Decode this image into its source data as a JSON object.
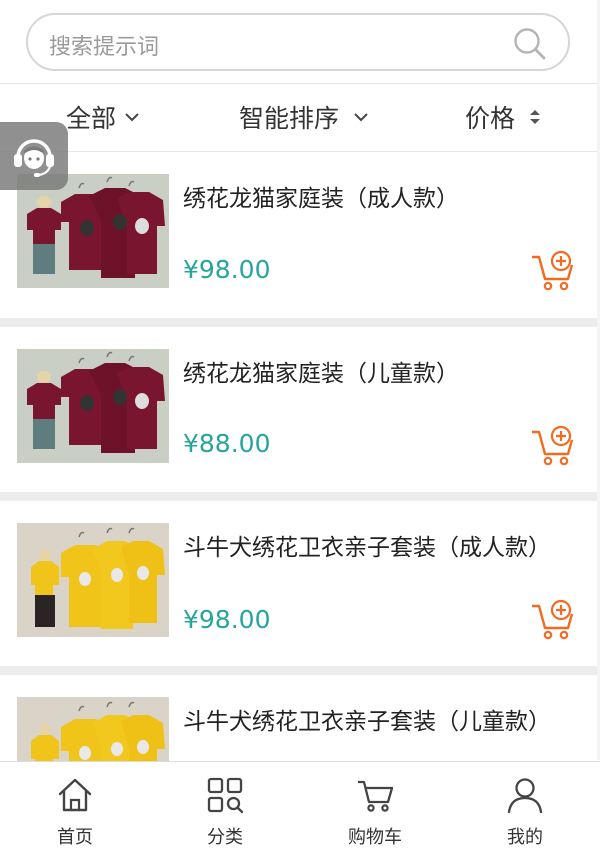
{
  "search": {
    "placeholder": "搜索提示词"
  },
  "filters": [
    {
      "label": "全部"
    },
    {
      "label": "智能排序"
    },
    {
      "label": "价格"
    }
  ],
  "products": [
    {
      "title": "绣花龙猫家庭装（成人款）",
      "price": "¥98.00",
      "image": "burgundy-totoro-family-sweaters"
    },
    {
      "title": "绣花龙猫家庭装（儿童款）",
      "price": "¥88.00",
      "image": "burgundy-totoro-family-sweaters"
    },
    {
      "title": "斗牛犬绣花卫衣亲子套装（成人款）",
      "price": "¥98.00",
      "image": "yellow-bulldog-family-sweatshirts"
    },
    {
      "title": "斗牛犬绣花卫衣亲子套装（儿童款）",
      "price": "",
      "image": "yellow-bulldog-family-sweatshirts"
    }
  ],
  "tabbar": [
    {
      "label": "首页",
      "icon": "home-icon"
    },
    {
      "label": "分类",
      "icon": "category-icon"
    },
    {
      "label": "购物车",
      "icon": "cart-icon"
    },
    {
      "label": "我的",
      "icon": "user-icon"
    }
  ],
  "colors": {
    "price": "#26a69a",
    "cart_add": "#f26b21",
    "divider": "#ececec"
  }
}
